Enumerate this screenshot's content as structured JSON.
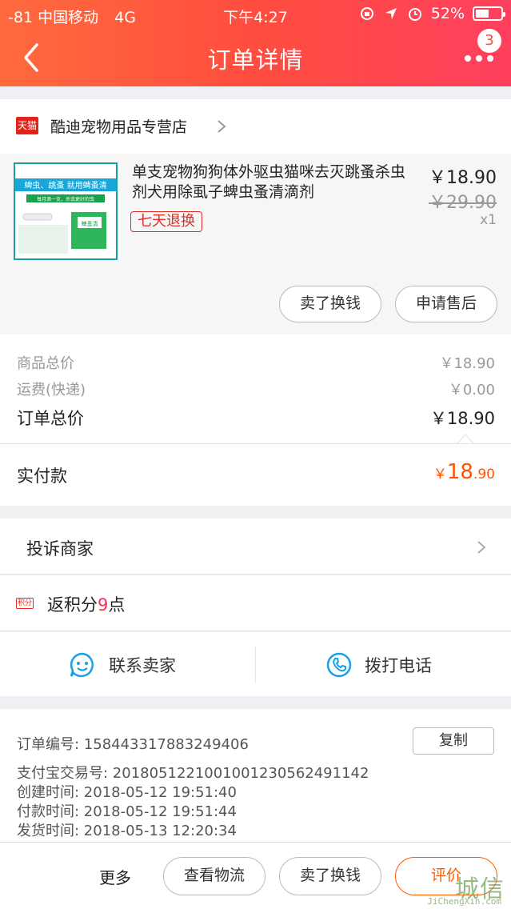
{
  "status_bar": {
    "carrier": "-81 中国移动",
    "network": "4G",
    "time": "下午4:27",
    "battery": "52%"
  },
  "nav": {
    "title": "订单详情",
    "badge_count": "3"
  },
  "store": {
    "tag": "天猫",
    "name": "酷迪宠物用品专营店"
  },
  "product": {
    "title": "单支宠物狗狗体外驱虫猫咪去灭跳蚤杀虫剂犬用除虱子蜱虫蚤清滴剂",
    "tag": "七天退换",
    "price": "￥18.90",
    "original_price": "￥29.90",
    "quantity": "x1",
    "thumb_banner": "蜱虫、跳蚤 就用蜱蚤清",
    "thumb_sub": "每月滴一支，杀虫更好的虫",
    "thumb_box": "蜱蚤清",
    "actions": [
      "卖了换钱",
      "申请售后"
    ]
  },
  "price_summary": {
    "items_label": "商品总价",
    "items_value": "￥18.90",
    "shipping_label": "运费(快递)",
    "shipping_value": "￥0.00",
    "total_label": "订单总价",
    "total_value": "￥18.90",
    "paid_label": "实付款",
    "paid_symbol": "￥",
    "paid_int": "18",
    "paid_dec": ".90"
  },
  "complain": {
    "label": "投诉商家"
  },
  "points": {
    "icon_text": "积分",
    "prefix": "返积分",
    "count": "9",
    "suffix": "点"
  },
  "contact": {
    "seller_label": "联系卖家",
    "call_label": "拨打电话"
  },
  "order_info": {
    "order_no": "订单编号:  1584433178832494​06",
    "alipay_no": "支付宝交易号:  2018051221001001230562491142",
    "created": "创建时间:  2018-05-12 19:51:40",
    "paid": "付款时间:  2018-05-12 19:51:44",
    "shipped": "发货时间:  2018-05-13 12:20:34",
    "copy_label": "复制"
  },
  "bottom_bar": {
    "more_label": "更多",
    "logistics_label": "查看物流",
    "sell_label": "卖了换钱",
    "review_label": "评价"
  },
  "watermark": {
    "main": "城信",
    "sub": "JiChengXin.com"
  },
  "colors": {
    "header_start": "#ff6a3d",
    "header_end": "#ff3f5e",
    "accent_orange": "#ff5500",
    "tag_red": "#e02e24",
    "contact_blue": "#1aa0e6"
  }
}
